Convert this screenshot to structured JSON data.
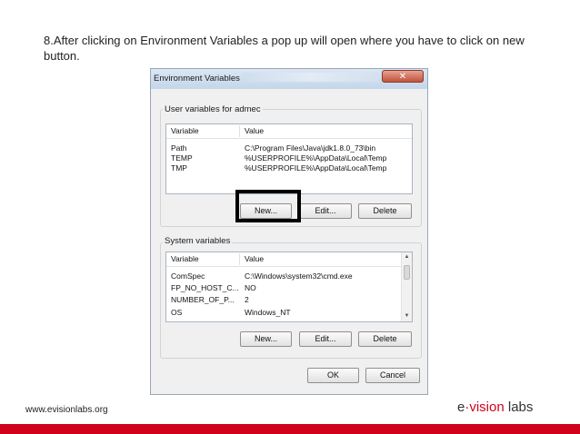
{
  "instruction": {
    "text": "8.After clicking on  Environment Variables a pop up will open where you have to click on new button."
  },
  "dialog": {
    "title": "Environment Variables",
    "close_label": "✕",
    "user_section": {
      "label": "User variables for admec",
      "columns": [
        "Variable",
        "Value"
      ],
      "rows": [
        {
          "variable": "Path",
          "value": "C:\\Program Files\\Java\\jdk1.8.0_73\\bin"
        },
        {
          "variable": "TEMP",
          "value": "%USERPROFILE%\\AppData\\Local\\Temp"
        },
        {
          "variable": "TMP",
          "value": "%USERPROFILE%\\AppData\\Local\\Temp"
        }
      ],
      "buttons": {
        "new": "New...",
        "edit": "Edit...",
        "delete": "Delete"
      }
    },
    "system_section": {
      "label": "System variables",
      "columns": [
        "Variable",
        "Value"
      ],
      "rows": [
        {
          "variable": "ComSpec",
          "value": "C:\\Windows\\system32\\cmd.exe"
        },
        {
          "variable": "FP_NO_HOST_C...",
          "value": "NO"
        },
        {
          "variable": "NUMBER_OF_P...",
          "value": "2"
        },
        {
          "variable": "OS",
          "value": "Windows_NT"
        }
      ],
      "buttons": {
        "new": "New...",
        "edit": "Edit...",
        "delete": "Delete"
      }
    },
    "ok_label": "OK",
    "cancel_label": "Cancel"
  },
  "footer": {
    "website": "www.evisionlabs.org",
    "logo_prefix": "e",
    "logo_dot": "·",
    "logo_accent": "vision",
    "logo_suffix": " labs",
    "brand_color": "#d0021b"
  }
}
